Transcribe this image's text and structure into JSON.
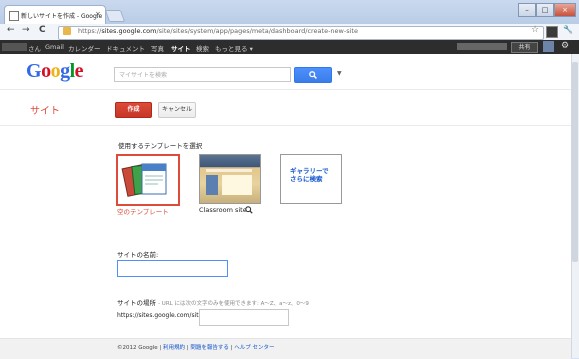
{
  "window": {
    "tab_title": "新しいサイトを作成 - Google",
    "tab_close": "×",
    "min": "–",
    "max": "□",
    "close": "×"
  },
  "toolbar": {
    "back": "←",
    "forward": "→",
    "reload": "C",
    "url_prefix": "https://",
    "url_host": "sites.google.com",
    "url_path": "/site/sites/system/app/pages/meta/dashboard/create-new-site",
    "star": "☆",
    "wrench": "🔧"
  },
  "gbar": {
    "items": [
      "さん",
      "Gmail",
      "カレンダー",
      "ドキュメント",
      "写真",
      "サイト",
      "検索",
      "もっと見る ▾"
    ],
    "share": "共有"
  },
  "header": {
    "logo": [
      "G",
      "o",
      "o",
      "g",
      "l",
      "e"
    ],
    "logo_colors": [
      "#3369e8",
      "#d50f25",
      "#eeb211",
      "#3369e8",
      "#009925",
      "#d50f25"
    ],
    "search_placeholder": "マイサイトを検索",
    "search_icon": "search-icon"
  },
  "action_bar": {
    "title": "サイト",
    "create": "作成",
    "cancel": "キャンセル"
  },
  "templates": {
    "heading": "使用するテンプレートを選択",
    "blank_caption": "空のテンプレート",
    "classroom_caption": "Classroom site",
    "gallery_line1": "ギャラリーで",
    "gallery_line2": "さらに検索"
  },
  "form": {
    "name_label": "サイトの名前:",
    "name_value": "",
    "location_label": "サイトの場所",
    "location_hint": "- URL には次の文字のみを使用できます: A～Z、a～z、0～9",
    "url_prefix": "https://sites.google.com/site/",
    "url_value": ""
  },
  "footer": {
    "copyright": "©2012 Google",
    "sep1": " | ",
    "terms": "利用規約",
    "sep2": " | ",
    "report": "問題を報告する",
    "sep3": " | ",
    "help": "ヘルプ センター"
  },
  "colors": {
    "accent_red": "#dd4b39",
    "search_blue": "#4d90fe",
    "link_blue": "#1155cc",
    "gbar_bg": "#2d2d2d"
  }
}
